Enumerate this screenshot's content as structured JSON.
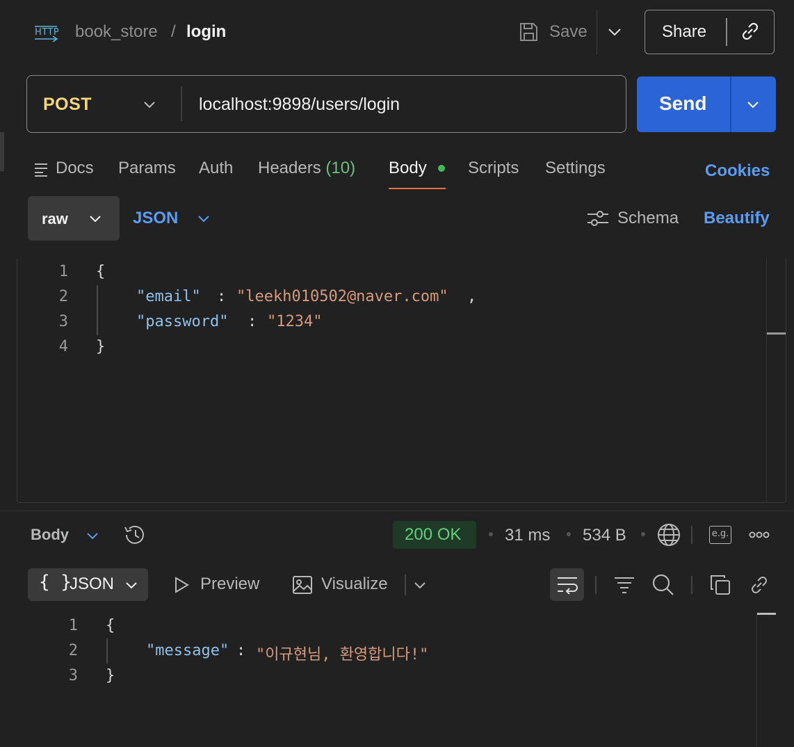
{
  "header": {
    "collection": "book_store",
    "separator": "/",
    "request_name": "login",
    "save_label": "Save",
    "share_label": "Share"
  },
  "request": {
    "method": "POST",
    "url": "localhost:9898/users/login",
    "send_label": "Send"
  },
  "tabs": {
    "docs": "Docs",
    "params": "Params",
    "auth": "Auth",
    "headers": "Headers",
    "headers_count": "(10)",
    "body": "Body",
    "scripts": "Scripts",
    "settings": "Settings",
    "cookies": "Cookies"
  },
  "body_options": {
    "mode": "raw",
    "language": "JSON",
    "schema": "Schema",
    "beautify": "Beautify"
  },
  "request_body": {
    "line_numbers": [
      "1",
      "2",
      "3",
      "4"
    ],
    "open_brace": "{",
    "close_brace": "}",
    "email_key": "\"email\"",
    "email_value": "\"leekh010502@naver.com\"",
    "password_key": "\"password\"",
    "password_value": "\"1234\""
  },
  "response": {
    "section_label": "Body",
    "status": "200 OK",
    "time": "31 ms",
    "size": "534 B",
    "example_label": "e.g.",
    "format": "JSON",
    "preview": "Preview",
    "visualize": "Visualize",
    "line_numbers": [
      "1",
      "2",
      "3"
    ],
    "open_brace": "{",
    "close_brace": "}",
    "message_key": "\"message\"",
    "message_value": "\"이규현님, 환영합니다!\""
  },
  "colors": {
    "accent_blue": "#2a64d6",
    "link_blue": "#5b9cf0",
    "method_yellow": "#f6d77a",
    "status_green": "#5fd07b",
    "active_tab_underline": "#e8703a"
  }
}
